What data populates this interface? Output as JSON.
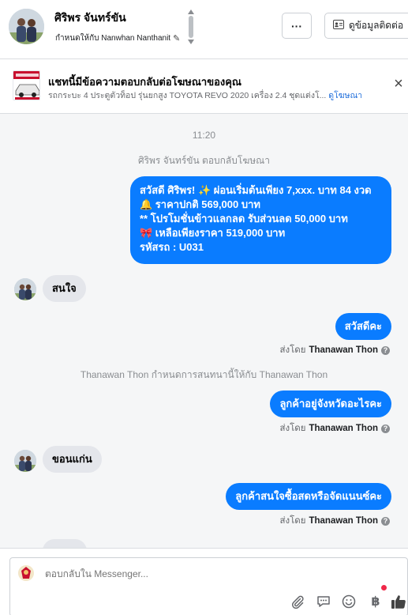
{
  "header": {
    "contact_name": "ศิริพร จันทร์ขัน",
    "assigned_to": "กำหนดให้กับ Nanwhan Nanthanit",
    "more_label": "···",
    "contact_info_label": "ดูข้อมูลติดต่อ"
  },
  "ad": {
    "title": "แชทนี้มีข้อความตอบกลับต่อโฆษณาของคุณ",
    "description": "รถกระบะ 4 ประตูตัวท็อป รุ่นยกสูง TOYOTA REVO 2020 เครื่อง 2.4 ชุดแต่งโ...",
    "link_label": "ดูโฆษณา"
  },
  "chat": {
    "timestamp": "11:20",
    "reply_note": "ศิริพร จันทร์ขัน ตอบกลับโฆษณา",
    "first_message": [
      "สวัสดี ศิริพร! ✨  ผ่อนเริ่มต้นเพียง 7,xxx. บาท 84 งวด",
      "🔔 ราคาปกติ 569,000 บาท",
      "** โปรโมชั่นข้าวแลกลด รับส่วนลด 50,000 บาท",
      "🎀  เหลือเพียงราคา 519,000 บาท",
      " รหัสรถ : U031"
    ],
    "msg_in_1": "สนใจ",
    "msg_out_1": "สวัสดีคะ",
    "sent_by_prefix": "ส่งโดย",
    "sender": "Thanawan Thon",
    "assign_note": "Thanawan Thon กำหนดการสนทนานี้ให้กับ Thanawan Thon",
    "msg_out_2": "ลูกค้าอยู่จังหวัดอะไรคะ",
    "msg_in_2": "ขอนแก่น",
    "msg_out_3": "ลูกค้าสนใจซื้อสดหรือจัดแนนซ์คะ",
    "help_icon_glyph": "?"
  },
  "composer": {
    "placeholder": "ตอบกลับใน Messenger..."
  },
  "colors": {
    "accent": "#0a7cff",
    "bubble_in": "#e4e6eb",
    "chat_bg": "#f5f6f7",
    "notification": "#f02849"
  },
  "icons": [
    "sort-arrows-icon",
    "pencil-icon",
    "more-icon",
    "contact-card-icon",
    "close-icon",
    "attachment-icon",
    "saved-reply-icon",
    "emoji-icon",
    "baht-icon",
    "like-icon"
  ]
}
